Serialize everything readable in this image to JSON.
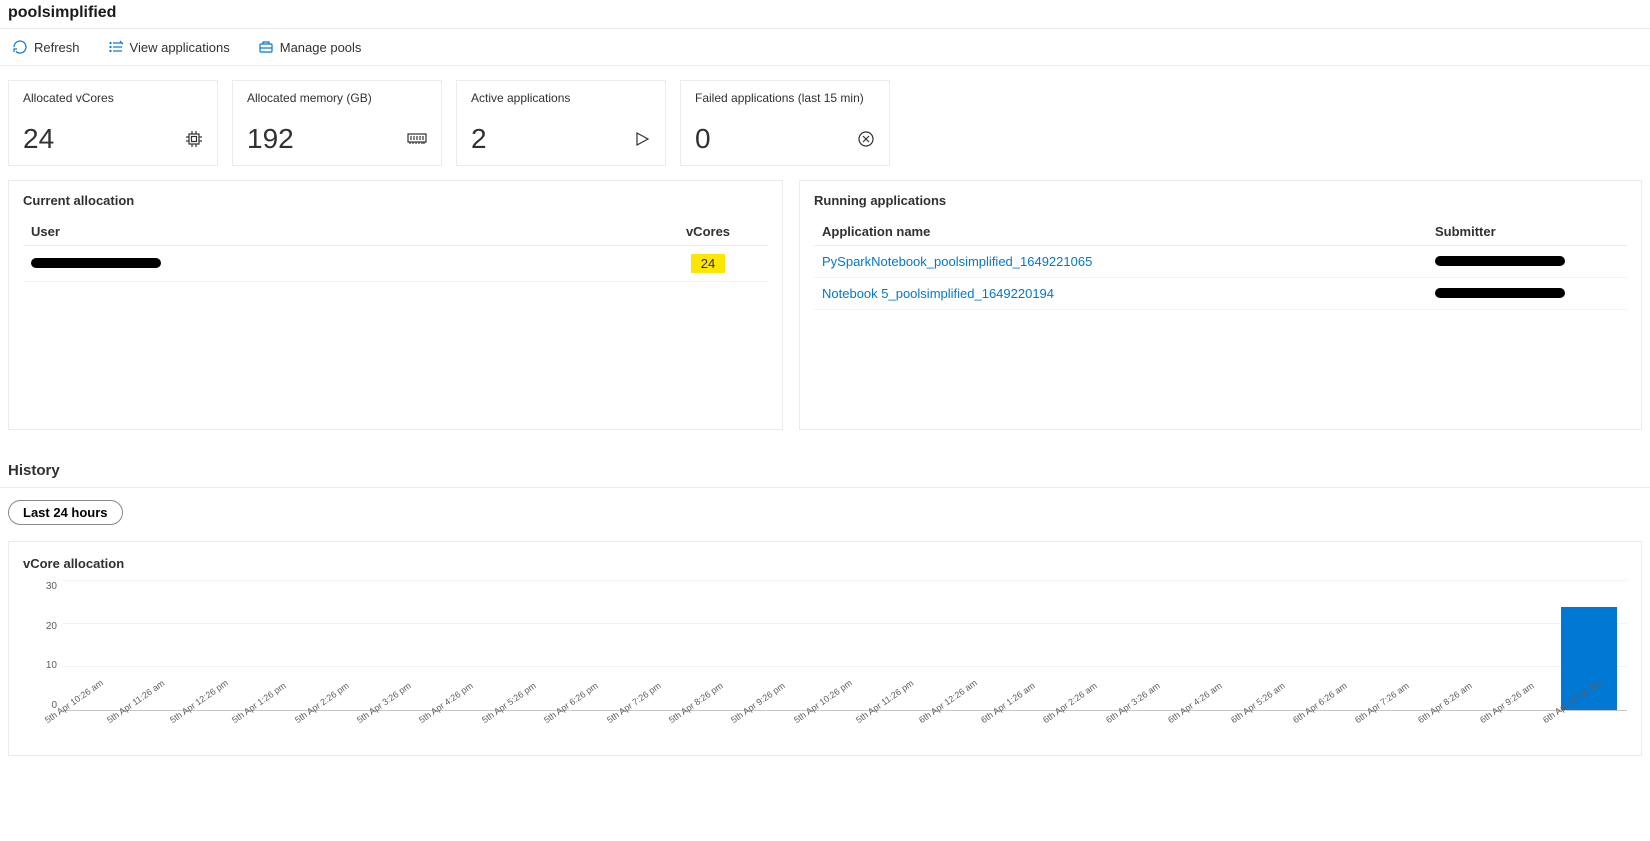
{
  "title": "poolsimplified",
  "toolbar": {
    "refresh": "Refresh",
    "view_apps": "View applications",
    "manage_pools": "Manage pools"
  },
  "cards": [
    {
      "label": "Allocated vCores",
      "value": "24",
      "icon": "cpu"
    },
    {
      "label": "Allocated memory (GB)",
      "value": "192",
      "icon": "memory"
    },
    {
      "label": "Active applications",
      "value": "2",
      "icon": "play"
    },
    {
      "label": "Failed applications (last 15 min)",
      "value": "0",
      "icon": "fail"
    }
  ],
  "allocation": {
    "title": "Current allocation",
    "headers": {
      "user": "User",
      "vcores": "vCores"
    },
    "rows": [
      {
        "user_redacted": true,
        "vcores": "24",
        "highlight": true
      }
    ]
  },
  "running": {
    "title": "Running applications",
    "headers": {
      "app": "Application name",
      "submitter": "Submitter"
    },
    "rows": [
      {
        "app": "PySparkNotebook_poolsimplified_1649221065",
        "submitter_redacted": true
      },
      {
        "app": "Notebook 5_poolsimplified_1649220194",
        "submitter_redacted": true
      }
    ]
  },
  "history": {
    "title": "History",
    "range_label": "Last 24 hours"
  },
  "chart_data": {
    "type": "bar",
    "title": "vCore allocation",
    "ylabel": "",
    "xlabel": "",
    "ylim": [
      0,
      30
    ],
    "yticks": [
      0,
      10,
      20,
      30
    ],
    "categories": [
      "5th Apr 10:26 am",
      "5th Apr 11:26 am",
      "5th Apr 12:26 pm",
      "5th Apr 1:26 pm",
      "5th Apr 2:26 pm",
      "5th Apr 3:26 pm",
      "5th Apr 4:26 pm",
      "5th Apr 5:26 pm",
      "5th Apr 6:26 pm",
      "5th Apr 7:26 pm",
      "5th Apr 8:26 pm",
      "5th Apr 9:26 pm",
      "5th Apr 10:26 pm",
      "5th Apr 11:26 pm",
      "6th Apr 12:26 am",
      "6th Apr 1:26 am",
      "6th Apr 2:26 am",
      "6th Apr 3:26 am",
      "6th Apr 4:26 am",
      "6th Apr 5:26 am",
      "6th Apr 6:26 am",
      "6th Apr 7:26 am",
      "6th Apr 8:26 am",
      "6th Apr 9:26 am",
      "6th Apr 10:26 am"
    ],
    "values": [
      0,
      0,
      0,
      0,
      0,
      0,
      0,
      0,
      0,
      0,
      0,
      0,
      0,
      0,
      0,
      0,
      0,
      0,
      0,
      0,
      0,
      0,
      0,
      0,
      24
    ]
  }
}
